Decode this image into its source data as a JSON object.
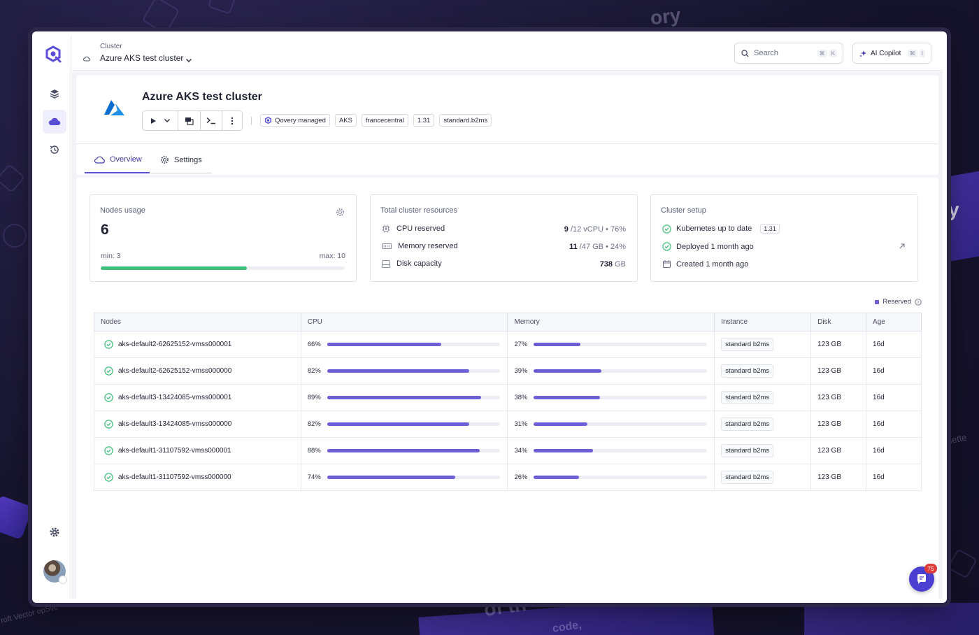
{
  "topbar": {
    "breadcrumb_label": "Cluster",
    "breadcrumb_value": "Azure AKS test cluster",
    "search_placeholder": "Search",
    "search_kbd_1": "⌘",
    "search_kbd_2": "K",
    "copilot_label": "AI Copilot",
    "copilot_kbd_1": "⌘",
    "copilot_kbd_2": "I"
  },
  "header": {
    "title": "Azure AKS test cluster",
    "tags": [
      "Qovery managed",
      "AKS",
      "francecentral",
      "1.31",
      "standard.b2ms"
    ]
  },
  "tabs": {
    "overview": "Overview",
    "settings": "Settings"
  },
  "nodes_usage": {
    "title": "Nodes usage",
    "count": "6",
    "min_label": "min: 3",
    "max_label": "max: 10",
    "fill_fraction": 0.6
  },
  "resources": {
    "title": "Total cluster resources",
    "rows": [
      {
        "label": "CPU reserved",
        "value": "9",
        "rest": " /12 vCPU  •  76%"
      },
      {
        "label": "Memory reserved",
        "value": "11",
        "rest": " /47 GB  •  24%"
      },
      {
        "label": "Disk capacity",
        "value": "738",
        "rest": " GB"
      }
    ]
  },
  "setup": {
    "title": "Cluster setup",
    "k8s_label": "Kubernetes up to date",
    "k8s_version": "1.31",
    "deployed": "Deployed 1 month ago",
    "created": "Created 1 month ago"
  },
  "legend": {
    "reserved": "Reserved"
  },
  "table": {
    "headers": [
      "Nodes",
      "CPU",
      "Memory",
      "Instance",
      "Disk",
      "Age"
    ],
    "rows": [
      {
        "name": "aks-default2-62625152-vmss000001",
        "cpu": "66%",
        "cpu_v": 66,
        "mem": "27%",
        "mem_v": 27,
        "instance": "standard b2ms",
        "disk": "123 GB",
        "age": "16d"
      },
      {
        "name": "aks-default2-62625152-vmss000000",
        "cpu": "82%",
        "cpu_v": 82,
        "mem": "39%",
        "mem_v": 39,
        "instance": "standard b2ms",
        "disk": "123 GB",
        "age": "16d"
      },
      {
        "name": "aks-default3-13424085-vmss000001",
        "cpu": "89%",
        "cpu_v": 89,
        "mem": "38%",
        "mem_v": 38,
        "instance": "standard b2ms",
        "disk": "123 GB",
        "age": "16d"
      },
      {
        "name": "aks-default3-13424085-vmss000000",
        "cpu": "82%",
        "cpu_v": 82,
        "mem": "31%",
        "mem_v": 31,
        "instance": "standard b2ms",
        "disk": "123 GB",
        "age": "16d"
      },
      {
        "name": "aks-default1-31107592-vmss000001",
        "cpu": "88%",
        "cpu_v": 88,
        "mem": "34%",
        "mem_v": 34,
        "instance": "standard b2ms",
        "disk": "123 GB",
        "age": "16d"
      },
      {
        "name": "aks-default1-31107592-vmss000000",
        "cpu": "74%",
        "cpu_v": 74,
        "mem": "26%",
        "mem_v": 26,
        "instance": "standard b2ms",
        "disk": "123 GB",
        "age": "16d"
      }
    ]
  },
  "chat": {
    "badge": "75"
  },
  "colors": {
    "accent": "#5b4ed6",
    "bar": "#6d5fd8",
    "success": "#3fc07a",
    "azure": "#0a6ed1"
  },
  "backdrop_text": [
    "ory",
    "of th",
    "code,",
    "y",
    "lette",
    "roft Vector opSvc"
  ]
}
